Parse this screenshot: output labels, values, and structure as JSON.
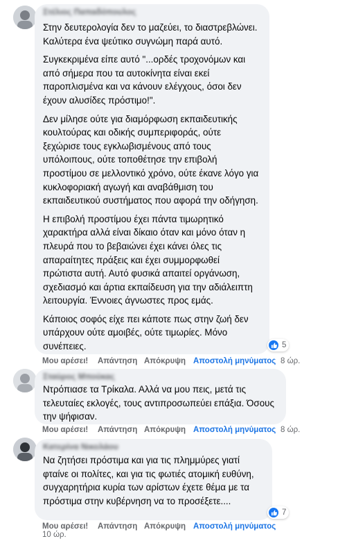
{
  "comments": [
    {
      "author": "Στέλιος Παπαδόπουλος",
      "paragraphs": [
        "Στην δευτερολογία δεν το μαζεύει, το διαστρεβλώνει. Καλύτερα ένα ψεύτικο συγνώμη παρά αυτό.",
        "Συγκεκριμένα είπε αυτό \"...ορδές τροχονόμων και από σήμερα που τα αυτοκίνητα είναι εκεί παροπλισμένα και να κάνουν ελέγχους, όσοι δεν έχουν αλυσίδες πρόστιμο!\".",
        "Δεν μίλησε ούτε για διαμόρφωση εκπαιδευτικής κουλτούρας και οδικής συμπεριφοράς, ούτε ξεχώρισε τους εγκλωβισμένους από τους υπόλοιπους, ούτε τοποθέτησε την επιβολή προστίμου σε μελλοντικό χρόνο, ούτε έκανε λόγο για κυκλοφοριακή αγωγή και αναβάθμιση του εκπαιδευτικού συστήματος που αφορά την οδήγηση.",
        "Η επιβολή προστίμου έχει πάντα τιμωρητικό χαρακτήρα αλλά είναι δίκαιο όταν και μόνο όταν η πλευρά που το βεβαιώνει έχει κάνει όλες τις απαραίτητες πράξεις και έχει συμμορφωθεί πρώτιστα αυτή. Αυτό φυσικά απαιτεί οργάνωση, σχεδιασμό και άρτια εκπαίδευση για την αδιάλειπτη λειτουργία. Έννοιες άγνωστες προς εμάς.",
        "Κάποιος σοφός είχε πει κάποτε πως στην ζωή δεν υπάρχουν ούτε αμοιβές, ούτε τιμωρίες. Μόνο συνέπειες."
      ],
      "reaction_count": "5",
      "actions": {
        "like": "Μου αρέσει!",
        "reply": "Απάντηση",
        "hide": "Απόκρυψη",
        "message": "Αποστολή μηνύματος",
        "time": "8 ώρ."
      }
    },
    {
      "author": "Σταύρος Μπούκας",
      "paragraphs": [
        "Ντρόπιασε τα Τρίκαλα. Αλλά να μου πεις, μετά τις τελευταίες εκλογές, τους αντιπροσωπεύει επάξια. Όσους την ψήφισαν."
      ],
      "actions": {
        "like": "Μου αρέσει!",
        "reply": "Απάντηση",
        "hide": "Απόκρυψη",
        "message": "Αποστολή μηνύματος",
        "time": "8 ώρ."
      }
    },
    {
      "author": "Κατερίνα Νικολάου",
      "paragraphs": [
        "Να ζητήσει πρόστιμα και για τις πλημμύρες γιατί φταίνε οι πολίτες, και για τις φωτιές ατομική ευθύνη, συγχαρητήρια κυρία των αρίστων έχετε θέμα με τα πρόστιμα στην κυβέρνηση να το προσέξετε...."
      ],
      "reaction_count": "7",
      "actions": {
        "like": "Μου αρέσει!",
        "reply": "Απάντηση",
        "hide": "Απόκρυψη",
        "message": "Αποστολή μηνύματος",
        "time": "10 ώρ."
      }
    }
  ],
  "colors": {
    "bubble": "#f0f2f5",
    "link": "#1b74e4",
    "like": "#1877f2",
    "meta": "#65676b"
  },
  "icons": {
    "reaction": "thumbs-up-icon",
    "avatar": "avatar-photo"
  }
}
